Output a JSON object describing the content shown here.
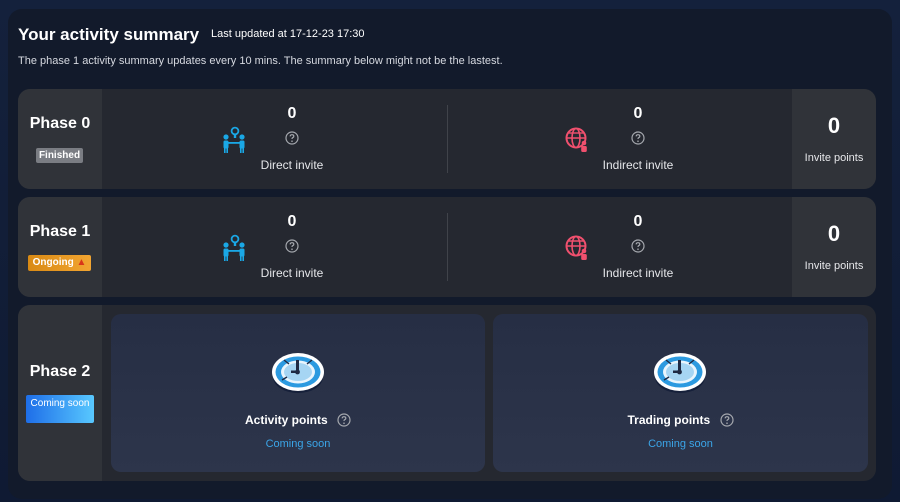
{
  "header": {
    "title": "Your activity summary",
    "last_updated": "Last updated at 17-12-23 17:30",
    "subtitle": "The phase 1 activity summary updates every 10 mins. The summary below might not be the lastest."
  },
  "phases": [
    {
      "name": "Phase 0",
      "status": "Finished",
      "direct_invite": {
        "value": "0",
        "label": "Direct invite",
        "icon": "people-invite-icon"
      },
      "indirect_invite": {
        "value": "0",
        "label": "Indirect invite",
        "icon": "globe-people-icon"
      },
      "invite_points": {
        "value": "0",
        "label": "Invite points"
      }
    },
    {
      "name": "Phase 1",
      "status": "Ongoing",
      "status_icon": "fire-icon",
      "direct_invite": {
        "value": "0",
        "label": "Direct invite",
        "icon": "people-invite-icon"
      },
      "indirect_invite": {
        "value": "0",
        "label": "Indirect invite",
        "icon": "globe-people-icon"
      },
      "invite_points": {
        "value": "0",
        "label": "Invite points"
      }
    },
    {
      "name": "Phase 2",
      "status": "Coming soon",
      "cards": [
        {
          "title": "Activity points",
          "status": "Coming soon",
          "icon": "clock-icon"
        },
        {
          "title": "Trading points",
          "status": "Coming soon",
          "icon": "clock-icon"
        }
      ]
    }
  ],
  "colors": {
    "panel_bg": "#121a2b",
    "row_bg": "#252830",
    "direct_icon": "#1aa8e6",
    "indirect_icon": "#f0506e",
    "coming_soon_text": "#3ba5e8",
    "finished_badge": "#7a7d83",
    "ongoing_badge": "#f2a531"
  }
}
